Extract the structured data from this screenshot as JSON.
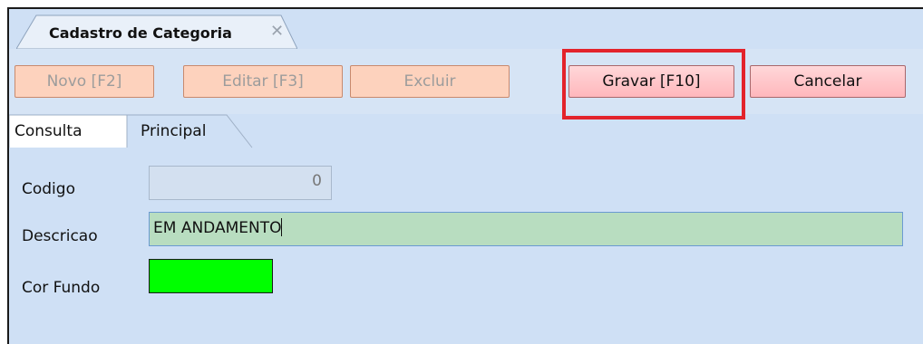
{
  "document_tab": {
    "title": "Cadastro de Categoria",
    "close_icon": "close-icon"
  },
  "toolbar": {
    "new_label": "Novo [F2]",
    "edit_label": "Editar [F3]",
    "delete_label": "Excluir",
    "save_label": "Gravar [F10]",
    "cancel_label": "Cancelar"
  },
  "tabs": [
    {
      "label": "Consulta"
    },
    {
      "label": "Principal"
    }
  ],
  "form": {
    "code_label": "Codigo",
    "code_value": "0",
    "description_label": "Descricao",
    "description_value": "EM ANDAMENTO",
    "background_color_label": "Cor Fundo",
    "background_color_value": "#00ff00"
  },
  "colors": {
    "panel_background": "#cfe0f5",
    "toolbar_button": "#fdd2bd",
    "active_button": "#ffb7bc",
    "highlight_border": "#e3232b",
    "description_field": "#b8ddc0"
  }
}
